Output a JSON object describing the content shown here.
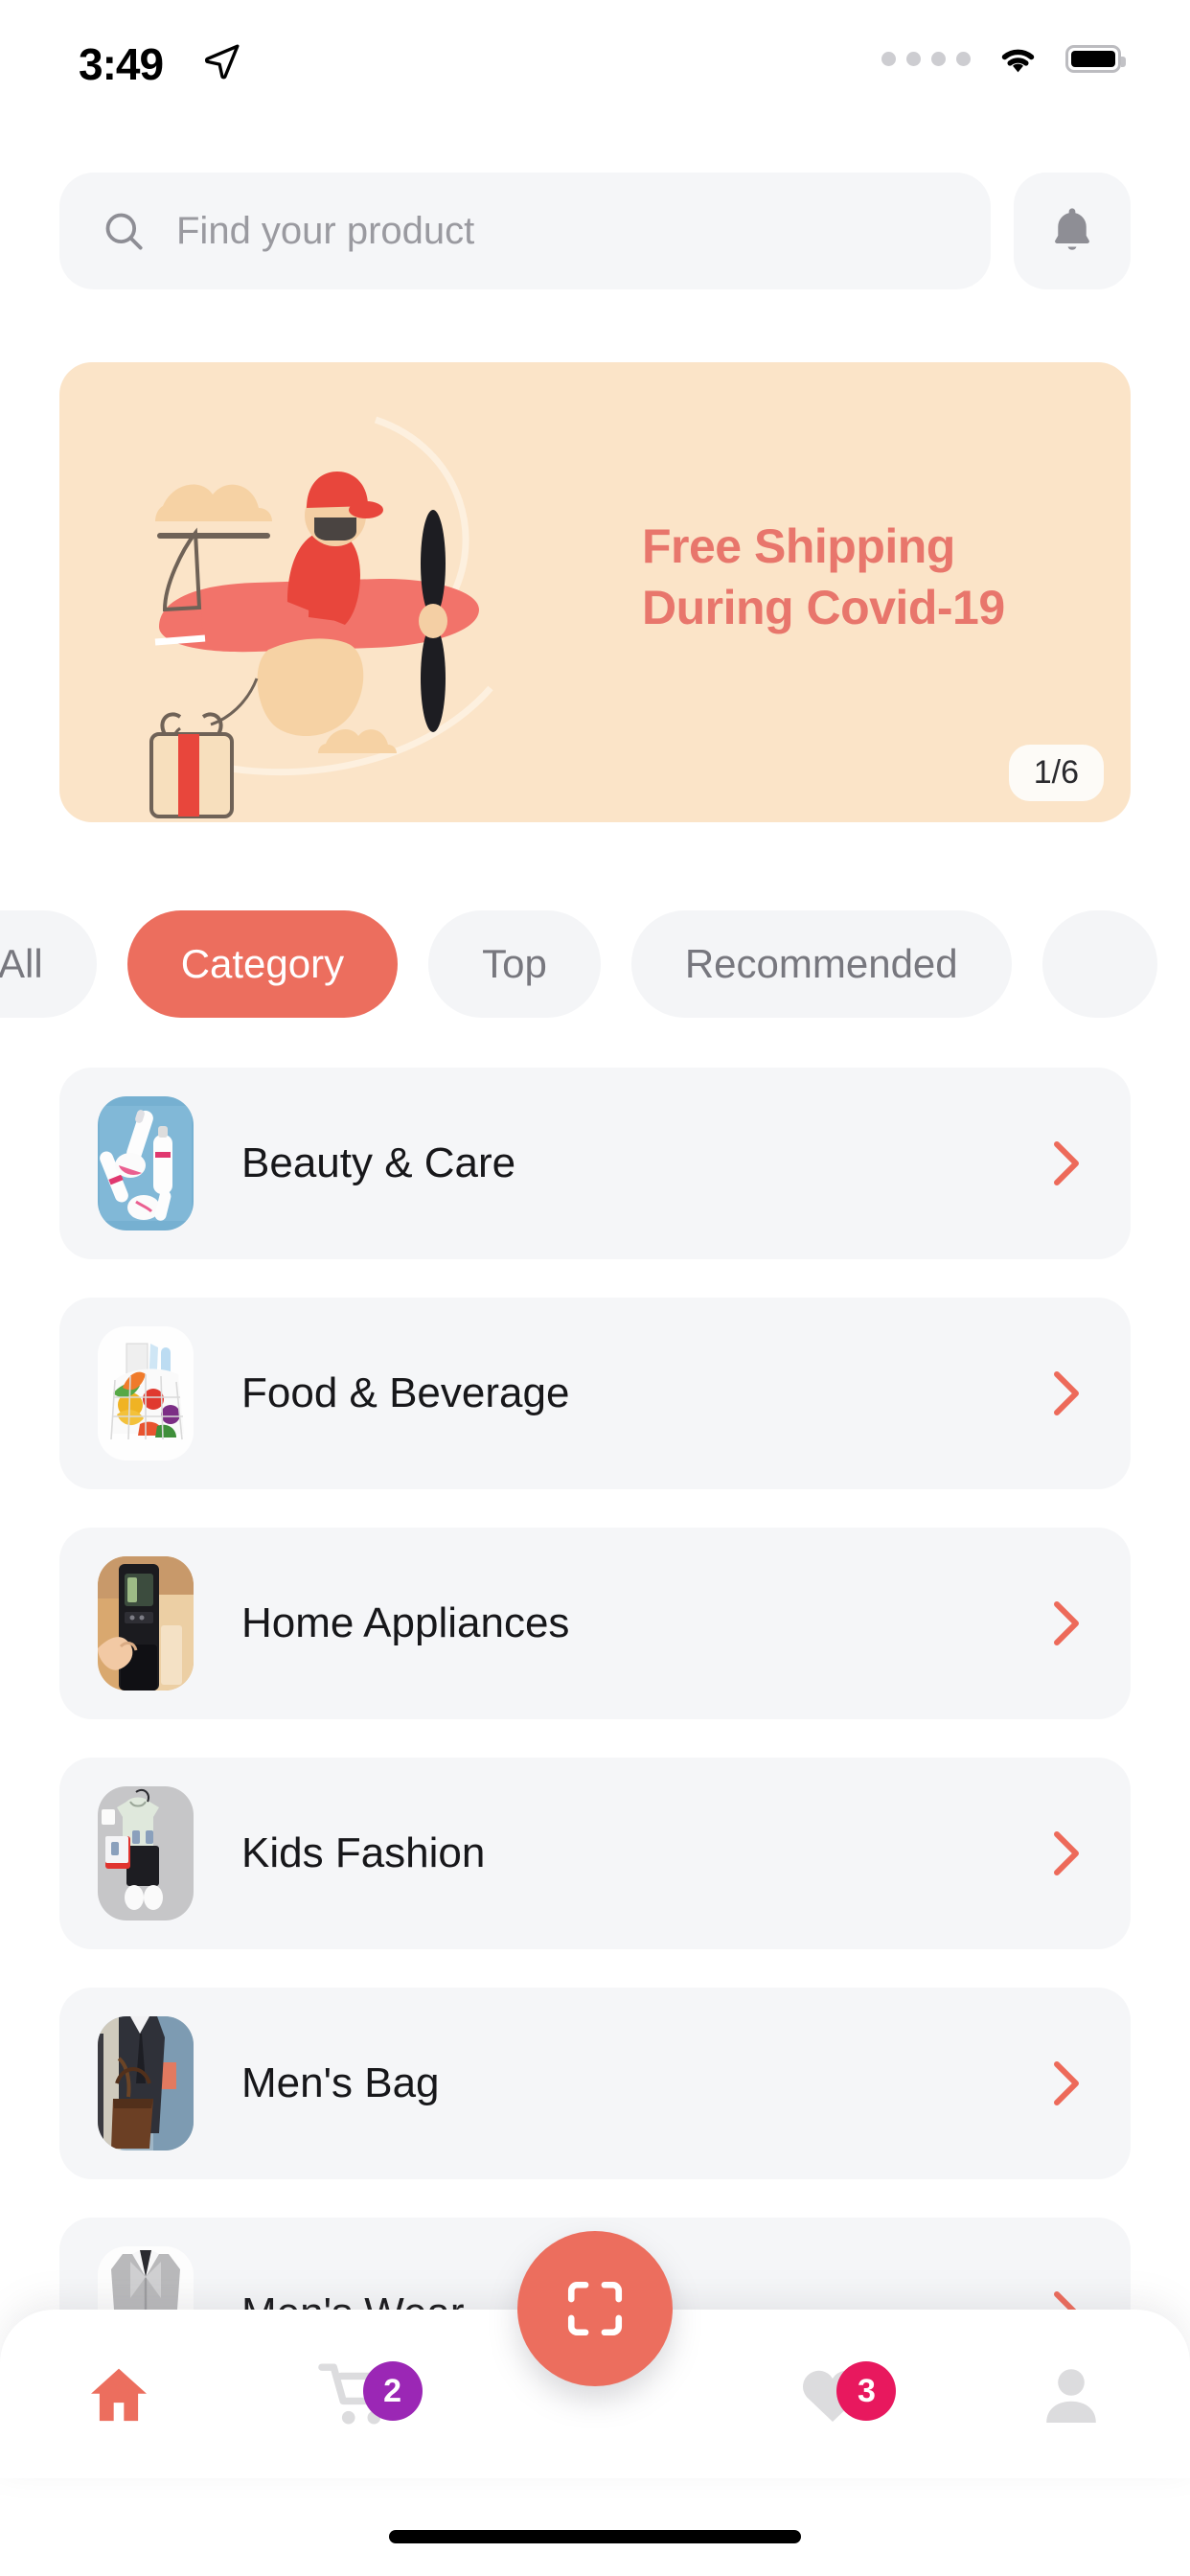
{
  "status_bar": {
    "time": "3:49",
    "location_icon": "location-arrow-icon",
    "signal_icon": "signal-dots-icon",
    "wifi_icon": "wifi-icon",
    "battery_icon": "battery-full-icon"
  },
  "header": {
    "search": {
      "icon": "search-icon",
      "placeholder": "Find your product",
      "value": ""
    },
    "notification": {
      "icon": "bell-icon"
    }
  },
  "banner": {
    "line1": "Free Shipping",
    "line2": "During Covid-19",
    "pagination": "1/6",
    "background_color": "#fbe4c8",
    "text_color": "#e8766c",
    "illustration": "airplane-pilot-illustration"
  },
  "filters": {
    "chips": [
      {
        "label": "All",
        "active": false
      },
      {
        "label": "Category",
        "active": true
      },
      {
        "label": "Top",
        "active": false
      },
      {
        "label": "Recommended",
        "active": false
      },
      {
        "label": "",
        "active": false
      }
    ],
    "active_color": "#ec6e5e"
  },
  "categories": {
    "chevron_icon": "chevron-right-icon",
    "items": [
      {
        "label": "Beauty & Care",
        "thumb": "cosmetics-bottles-photo"
      },
      {
        "label": "Food & Beverage",
        "thumb": "grocery-basket-photo"
      },
      {
        "label": "Home Appliances",
        "thumb": "water-dispenser-photo"
      },
      {
        "label": "Kids Fashion",
        "thumb": "kids-outfit-photo"
      },
      {
        "label": "Men's Bag",
        "thumb": "man-leather-bag-photo"
      },
      {
        "label": "Men's Wear",
        "thumb": "gray-suit-photo"
      }
    ]
  },
  "bottom_nav": {
    "items": [
      {
        "name": "home",
        "icon": "home-icon",
        "active": true,
        "badge": null,
        "badge_color": null
      },
      {
        "name": "cart",
        "icon": "cart-icon",
        "active": false,
        "badge": "2",
        "badge_color": "#9b27b5"
      },
      {
        "name": "favorites",
        "icon": "heart-icon",
        "active": false,
        "badge": "3",
        "badge_color": "#e8185e"
      },
      {
        "name": "profile",
        "icon": "profile-icon",
        "active": false,
        "badge": null,
        "badge_color": null
      }
    ],
    "fab": {
      "icon": "scan-icon",
      "color": "#ec6e5e"
    }
  }
}
